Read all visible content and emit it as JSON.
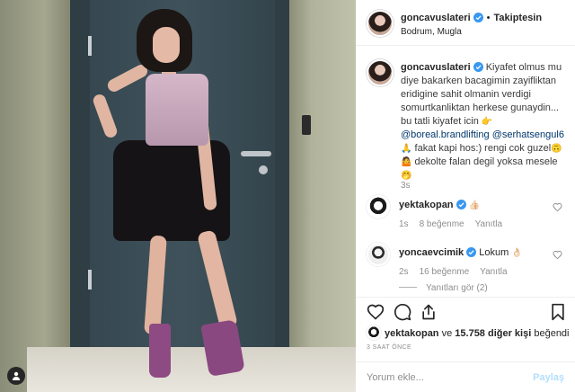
{
  "post": {
    "username": "goncavuslateri",
    "follow_label": "Takiptesin",
    "location": "Bodrum, Mugla",
    "caption": {
      "line1": "Kiyafet olmus mu",
      "line2": "diye bakarken bacagimin zayifliktan",
      "line3": "eridigine sahit olmanin verdigi",
      "line4": "somurtkanliktan herkese gunaydin...",
      "line5": "bu tatli kiyafet icin",
      "mention1": "@boreal.brandlifting",
      "mention2": "@serhatsengul6",
      "line7": "fakat kapi hos:) rengi cok guzel",
      "line8": "dekolte falan degil yoksa mesele"
    },
    "caption_time": "3s"
  },
  "comments": [
    {
      "username": "yektakopan",
      "text": "",
      "time": "1s",
      "likes": "8 beğenme",
      "reply": "Yanıtla"
    },
    {
      "username": "yoncaevcimik",
      "text": "Lokum",
      "time": "2s",
      "likes": "16 beğenme",
      "reply": "Yanıtla"
    }
  ],
  "replies_toggle": "Yanıtları gör (2)",
  "likes": {
    "user": "yektakopan",
    "conj": "ve",
    "others": "15.758 diğer kişi",
    "suffix": "beğendi"
  },
  "timestamp": "3 SAAT ÖNCE",
  "add_comment": {
    "placeholder": "Yorum ekle...",
    "post_label": "Paylaş"
  },
  "colors": {
    "verified": "#3897f0",
    "mention": "#00376b",
    "meta": "#8e8e8e",
    "post_disabled": "#b2dffc"
  },
  "icons": [
    "user-tag-icon",
    "verified-icon",
    "heart-icon",
    "comment-icon",
    "share-icon",
    "bookmark-icon"
  ]
}
